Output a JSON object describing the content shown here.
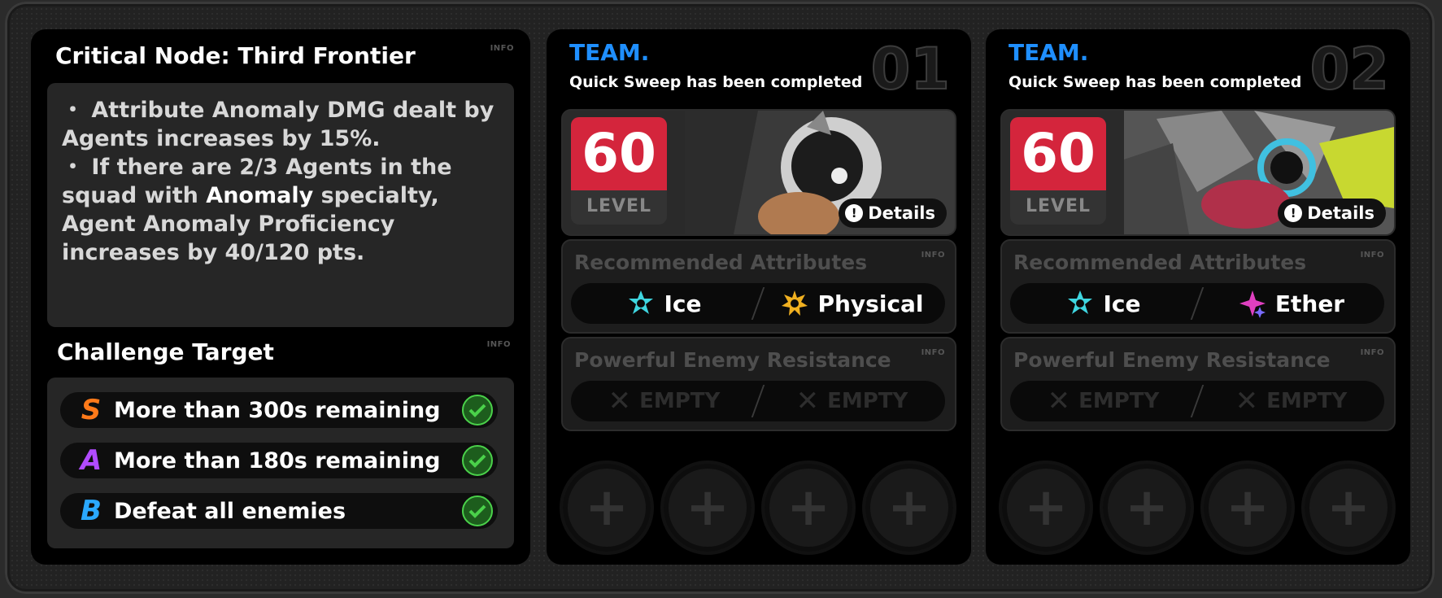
{
  "node": {
    "title": "Critical Node: Third Frontier",
    "info_label": "INFO",
    "desc_1a": "・ Attribute Anomaly DMG dealt by Agents increases by 15%.",
    "desc_2a": "・ If there are 2/3 Agents in the squad with ",
    "desc_2b": "Anomaly",
    "desc_2c": " specialty, Agent Anomaly Proficiency increases by 40/120 pts."
  },
  "challenge": {
    "title": "Challenge Target",
    "info_label": "INFO",
    "targets": [
      {
        "grade": "S",
        "text": "More than 300s remaining",
        "color": "#ff7a1a"
      },
      {
        "grade": "A",
        "text": "More than 180s remaining",
        "color": "#b14bff"
      },
      {
        "grade": "B",
        "text": "Defeat all enemies",
        "color": "#2aa8ff"
      }
    ]
  },
  "teams": [
    {
      "label": "TEAM.",
      "status": "Quick Sweep has been completed",
      "number": "01",
      "level": "60",
      "level_label": "LEVEL",
      "details": "Details",
      "rec_title": "Recommended Attributes",
      "rec": [
        {
          "name": "Ice",
          "icon": "ice-icon",
          "color": "#3fd6e0"
        },
        {
          "name": "Physical",
          "icon": "physical-icon",
          "color": "#f0b020"
        }
      ],
      "res_title": "Powerful Enemy Resistance",
      "res": [
        "EMPTY",
        "EMPTY"
      ],
      "info_label": "INFO"
    },
    {
      "label": "TEAM.",
      "status": "Quick Sweep has been completed",
      "number": "02",
      "level": "60",
      "level_label": "LEVEL",
      "details": "Details",
      "rec_title": "Recommended Attributes",
      "rec": [
        {
          "name": "Ice",
          "icon": "ice-icon",
          "color": "#3fd6e0"
        },
        {
          "name": "Ether",
          "icon": "ether-icon",
          "color": "#e040c0"
        }
      ],
      "res_title": "Powerful Enemy Resistance",
      "res": [
        "EMPTY",
        "EMPTY"
      ],
      "info_label": "INFO"
    }
  ],
  "colors": {
    "team_accent": "#1f8fff",
    "level_red": "#d4253c",
    "check_green": "#4ad14a"
  }
}
